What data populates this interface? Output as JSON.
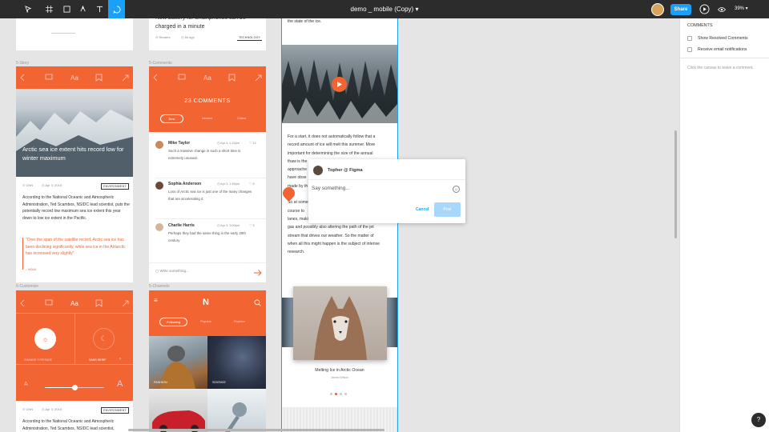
{
  "toolbar": {
    "doc_title": "demo _ mobile (Copy)",
    "share_label": "Share",
    "zoom": "39%"
  },
  "frames": {
    "story_label": "5-Story",
    "comments_label": "5-Comments",
    "customize_label": "6-Customize",
    "channels_label": "5-Channels"
  },
  "story": {
    "headline": "Arctic sea ice extent hits record low for winter maximum",
    "source": "CNN",
    "date": "Apr 3, 2015",
    "tag": "ENVIRONMENT",
    "body": "According to the National Oceanic and Atmospheric Administration, Ted Scambos, NSIDC lead scientist, puts the potentially record low maximum sea ice extent this year down to low ice extent in the Pacific.",
    "quote": "\"Over the span of the satellite record, Arctic sea ice has been declining significantly, while sea ice in the Antarctic has increased very slightly\"",
    "quote_source": "– NOAA"
  },
  "top_article": {
    "headline": "New battery for smartphones can be charged in a minute",
    "source": "Reuters",
    "time": "6h ago",
    "tag": "TECHNOLOGY"
  },
  "comments_frame": {
    "count_title": "23 COMMENTS",
    "tabs": [
      "Best",
      "Newest",
      "Oldest"
    ],
    "comments": [
      {
        "name": "Mike Taylor",
        "date": "Apr 3,",
        "time": "1:22pm",
        "likes": "12",
        "text": "Such a massive change in such a short time is extremely unusual."
      },
      {
        "name": "Sophia Anderson",
        "date": "Apr 3,",
        "time": "1:45pm",
        "likes": "8",
        "text": "Loss of Arctic sea ice is just one of the many changes that are accelerating it."
      },
      {
        "name": "Charlie Harris",
        "date": "Apr 3,",
        "time": "3:00pm",
        "likes": "5",
        "text": "Perhaps they had the same thing in the early 20th century"
      }
    ],
    "write_placeholder": "Write something..."
  },
  "customize": {
    "typeface_left": "CHANGE TYPEFACE",
    "typeface_right": "SANS SERIF",
    "font_small": "A",
    "font_large": "A",
    "slider_value": 0.5,
    "source": "CNN",
    "date": "Apr 3, 2015",
    "tag": "ENVIRONMENT",
    "body": "According to the National Oceanic and Atmospheric Administration, Ted Scambos, NSIDC lead scientist,"
  },
  "channels": {
    "logo": "N",
    "tabs": [
      "Following",
      "Popular",
      "Explore"
    ],
    "tiles": [
      "FASHION",
      "SCIENCE"
    ]
  },
  "article": {
    "top_text": "the state of the ice.",
    "lines": [
      "For a start, it does not automatically follow that a",
      "record amount of ice will melt this summer. More",
      "important for determining the size of the annual",
      "thaw is the",
      "approache",
      "have obse",
      "made by th",
      "",
      "So at some",
      "course to",
      "lanes, making it easier to access the region's oil and",
      "gas and possibly also altering the path of the jet",
      "stream that drives our weather. So the matter of",
      "when all this might happen is the subject of intense",
      "research."
    ],
    "gallery_title": "Melting Ice in Arctic Ocean",
    "gallery_credit": "James Wilson"
  },
  "popover": {
    "user": "Topher @ Figma",
    "placeholder": "Say something...",
    "cancel_label": "Cancel",
    "post_label": "Post"
  },
  "panel": {
    "title": "COMMENTS",
    "show_resolved": "Show Resolved Comments",
    "email_notify": "Receive email notifications",
    "hint": "Click the canvas to leave a comment."
  },
  "help_label": "?",
  "colors": {
    "accent": "#f26432",
    "figma_blue": "#18a0fb",
    "toolbar_bg": "#2c2c2c"
  }
}
